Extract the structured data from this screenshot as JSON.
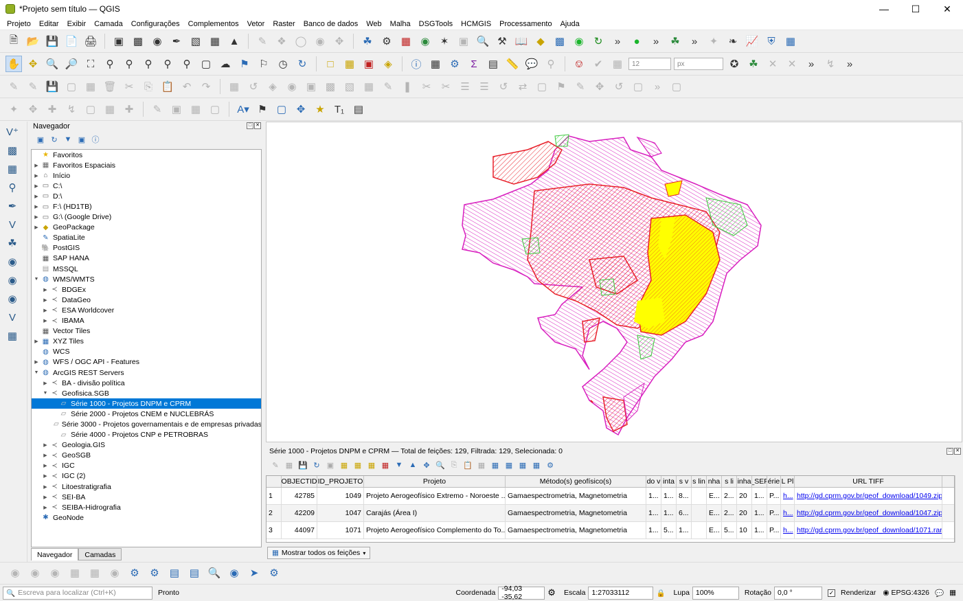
{
  "window": {
    "title": "*Projeto sem título — QGIS"
  },
  "menu": [
    "Projeto",
    "Editar",
    "Exibir",
    "Camada",
    "Configurações",
    "Complementos",
    "Vetor",
    "Raster",
    "Banco de dados",
    "Web",
    "Malha",
    "DSGTools",
    "HCMGIS",
    "Processamento",
    "Ajuda"
  ],
  "toolbar": {
    "size_value": "12",
    "unit_value": "px"
  },
  "browser": {
    "title": "Navegador",
    "tabs": [
      "Navegador",
      "Camadas"
    ],
    "items": [
      {
        "label": "Favoritos",
        "level": 0,
        "arrow": "",
        "icon": "★",
        "color": "#e8b400"
      },
      {
        "label": "Favoritos Espaciais",
        "level": 0,
        "arrow": "▶",
        "icon": "▦",
        "color": "#666"
      },
      {
        "label": "Início",
        "level": 0,
        "arrow": "▶",
        "icon": "⌂",
        "color": "#666"
      },
      {
        "label": "C:\\",
        "level": 0,
        "arrow": "▶",
        "icon": "▭",
        "color": "#666"
      },
      {
        "label": "D:\\",
        "level": 0,
        "arrow": "▶",
        "icon": "▭",
        "color": "#666"
      },
      {
        "label": "F:\\ (HD1TB)",
        "level": 0,
        "arrow": "▶",
        "icon": "▭",
        "color": "#666"
      },
      {
        "label": "G:\\ (Google Drive)",
        "level": 0,
        "arrow": "▶",
        "icon": "▭",
        "color": "#666"
      },
      {
        "label": "GeoPackage",
        "level": 0,
        "arrow": "▶",
        "icon": "◆",
        "color": "#c9a400"
      },
      {
        "label": "SpatiaLite",
        "level": 0,
        "arrow": "",
        "icon": "✎",
        "color": "#2b6bb5"
      },
      {
        "label": "PostGIS",
        "level": 0,
        "arrow": "",
        "icon": "🐘",
        "color": "#2b6bb5"
      },
      {
        "label": "SAP HANA",
        "level": 0,
        "arrow": "",
        "icon": "▦",
        "color": "#555"
      },
      {
        "label": "MSSQL",
        "level": 0,
        "arrow": "",
        "icon": "▤",
        "color": "#999"
      },
      {
        "label": "WMS/WMTS",
        "level": 0,
        "arrow": "▼",
        "icon": "◍",
        "color": "#2b6bb5"
      },
      {
        "label": "BDGEx",
        "level": 1,
        "arrow": "▶",
        "icon": "≺",
        "color": "#555"
      },
      {
        "label": "DataGeo",
        "level": 1,
        "arrow": "▶",
        "icon": "≺",
        "color": "#555"
      },
      {
        "label": "ESA Worldcover",
        "level": 1,
        "arrow": "▶",
        "icon": "≺",
        "color": "#555"
      },
      {
        "label": "IBAMA",
        "level": 1,
        "arrow": "▶",
        "icon": "≺",
        "color": "#555"
      },
      {
        "label": "Vector Tiles",
        "level": 0,
        "arrow": "",
        "icon": "▦",
        "color": "#555"
      },
      {
        "label": "XYZ Tiles",
        "level": 0,
        "arrow": "▶",
        "icon": "▦",
        "color": "#2b6bb5"
      },
      {
        "label": "WCS",
        "level": 0,
        "arrow": "",
        "icon": "◍",
        "color": "#2b6bb5"
      },
      {
        "label": "WFS / OGC API - Features",
        "level": 0,
        "arrow": "▶",
        "icon": "◍",
        "color": "#2b6bb5"
      },
      {
        "label": "ArcGIS REST Servers",
        "level": 0,
        "arrow": "▼",
        "icon": "◍",
        "color": "#2b6bb5"
      },
      {
        "label": "BA - divisão política",
        "level": 1,
        "arrow": "▶",
        "icon": "≺",
        "color": "#555"
      },
      {
        "label": "Geofisica.SGB",
        "level": 1,
        "arrow": "▼",
        "icon": "≺",
        "color": "#555"
      },
      {
        "label": "Série 1000 - Projetos DNPM e CPRM",
        "level": 2,
        "arrow": "",
        "icon": "▱",
        "color": "#ccc",
        "selected": true
      },
      {
        "label": "Série 2000 - Projetos CNEM e NUCLEBRÁS",
        "level": 2,
        "arrow": "",
        "icon": "▱",
        "color": "#888"
      },
      {
        "label": "Série 3000 - Projetos governamentais e de empresas privadas",
        "level": 2,
        "arrow": "",
        "icon": "▱",
        "color": "#888"
      },
      {
        "label": "Série 4000 - Projetos CNP e PETROBRAS",
        "level": 2,
        "arrow": "",
        "icon": "▱",
        "color": "#888"
      },
      {
        "label": "Geologia.GIS",
        "level": 1,
        "arrow": "▶",
        "icon": "≺",
        "color": "#555"
      },
      {
        "label": "GeoSGB",
        "level": 1,
        "arrow": "▶",
        "icon": "≺",
        "color": "#555"
      },
      {
        "label": "IGC",
        "level": 1,
        "arrow": "▶",
        "icon": "≺",
        "color": "#555"
      },
      {
        "label": "IGC (2)",
        "level": 1,
        "arrow": "▶",
        "icon": "≺",
        "color": "#555"
      },
      {
        "label": "Litoestratigrafia",
        "level": 1,
        "arrow": "▶",
        "icon": "≺",
        "color": "#555"
      },
      {
        "label": "SEI-BA",
        "level": 1,
        "arrow": "▶",
        "icon": "≺",
        "color": "#555"
      },
      {
        "label": "SEIBA-Hidrografia",
        "level": 1,
        "arrow": "▶",
        "icon": "≺",
        "color": "#555"
      },
      {
        "label": "GeoNode",
        "level": 0,
        "arrow": "",
        "icon": "✱",
        "color": "#2b6bb5"
      }
    ]
  },
  "attribute_table": {
    "title": "Série 1000 - Projetos DNPM e CPRM — Total de feições: 129, Filtrada: 129, Selecionada: 0",
    "show_all": "Mostrar todos os feições",
    "columns": [
      "OBJECTID",
      "ID_PROJETO",
      "Projeto",
      "Método(s) geofísico(s)",
      "do v",
      "inta",
      "s v",
      "s lin",
      "nha",
      "s li",
      "inha",
      "_SEF",
      "érie",
      "L Pl",
      "URL TIFF"
    ],
    "rows": [
      {
        "n": "1",
        "cells": [
          "42785",
          "1049",
          "Projeto Aerogeofísico Extremo - Noroeste ...",
          "Gamaespectrometria, Magnetometria",
          "1...",
          "1...",
          "8...",
          "",
          "E...",
          "2...",
          "20",
          "1...",
          "P...",
          "h...",
          "http://gd.cprm.gov.br/geof_download/1049.zip"
        ]
      },
      {
        "n": "2",
        "cells": [
          "42209",
          "1047",
          "Carajás (Área I)",
          "Gamaespectrometria, Magnetometria",
          "1...",
          "1...",
          "6...",
          "",
          "E...",
          "2...",
          "20",
          "1...",
          "P...",
          "h...",
          "http://gd.cprm.gov.br/geof_download/1047.zip"
        ]
      },
      {
        "n": "3",
        "cells": [
          "44097",
          "1071",
          "Projeto Aerogeofísico Complemento do To...",
          "Gamaespectrometria, Magnetometria",
          "1...",
          "5...",
          "1...",
          "",
          "E...",
          "5...",
          "10",
          "1...",
          "P...",
          "h...",
          "http://gd.cprm.gov.br/geof_download/1071.rar"
        ]
      }
    ]
  },
  "status": {
    "search_placeholder": "Escreva para localizar (Ctrl+K)",
    "ready": "Pronto",
    "coord_label": "Coordenada",
    "coord_value": "-94,03 -35,62",
    "scale_label": "Escala",
    "scale_value": "1:27033112",
    "lupa_label": "Lupa",
    "lupa_value": "100%",
    "rot_label": "Rotação",
    "rot_value": "0,0 °",
    "render_label": "Renderizar",
    "crs": "EPSG:4326"
  },
  "colors": {
    "red": "#e8202a",
    "magenta": "#d81fbf",
    "yellow": "#ffff00",
    "green": "#3cc83c",
    "selection": "#0078d7"
  }
}
